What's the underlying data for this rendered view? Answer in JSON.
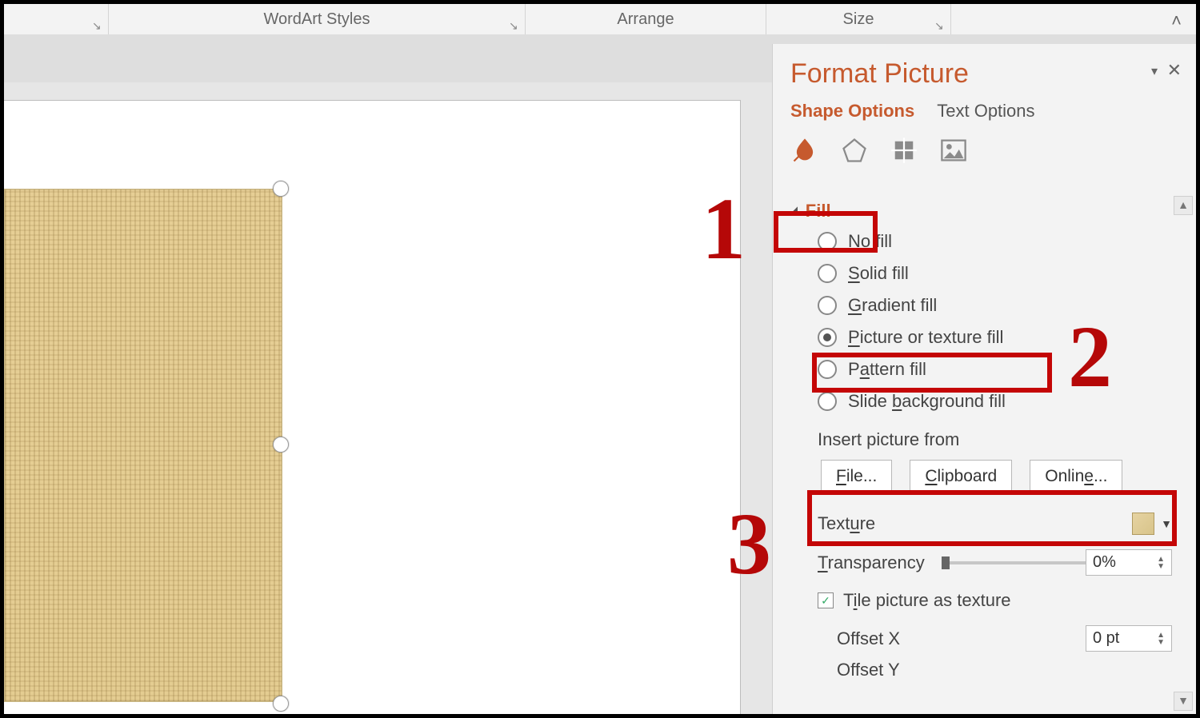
{
  "ribbon": {
    "groups": [
      {
        "label": ""
      },
      {
        "label": "WordArt Styles"
      },
      {
        "label": "Arrange"
      },
      {
        "label": "Size"
      }
    ]
  },
  "pane": {
    "title": "Format Picture",
    "tabs": {
      "shape": "Shape Options",
      "text": "Text Options"
    },
    "section": "Fill",
    "fill_options": {
      "none": {
        "label_pre": "",
        "u": "N",
        "label_post": "o fill"
      },
      "solid": {
        "label_pre": "",
        "u": "S",
        "label_post": "olid fill"
      },
      "gradient": {
        "label_pre": "",
        "u": "G",
        "label_post": "radient fill"
      },
      "picture": {
        "label_pre": "",
        "u": "P",
        "label_post": "icture or texture fill"
      },
      "pattern": {
        "label_pre": "P",
        "u": "a",
        "label_post": "ttern fill"
      },
      "slidebg": {
        "label_pre": "Slide ",
        "u": "b",
        "label_post": "ackground fill"
      }
    },
    "insert_label": "Insert picture from",
    "buttons": {
      "file": {
        "u": "F",
        "rest": "ile..."
      },
      "clipboard": {
        "u": "C",
        "rest": "lipboard"
      },
      "online": {
        "pre": "Onlin",
        "u": "e",
        "rest": "..."
      }
    },
    "texture": {
      "label_pre": "Text",
      "u": "u",
      "label_post": "re"
    },
    "transparency": {
      "u": "T",
      "rest": "ransparency",
      "value": "0%"
    },
    "tile": {
      "label_pre": "T",
      "u": "i",
      "label_post": "le picture as texture",
      "checked": true
    },
    "offsetx": {
      "label": "Offset X",
      "value": "0 pt"
    },
    "offsety": {
      "label": "Offset Y"
    }
  },
  "annotations": {
    "n1": "1",
    "n2": "2",
    "n3": "3"
  }
}
